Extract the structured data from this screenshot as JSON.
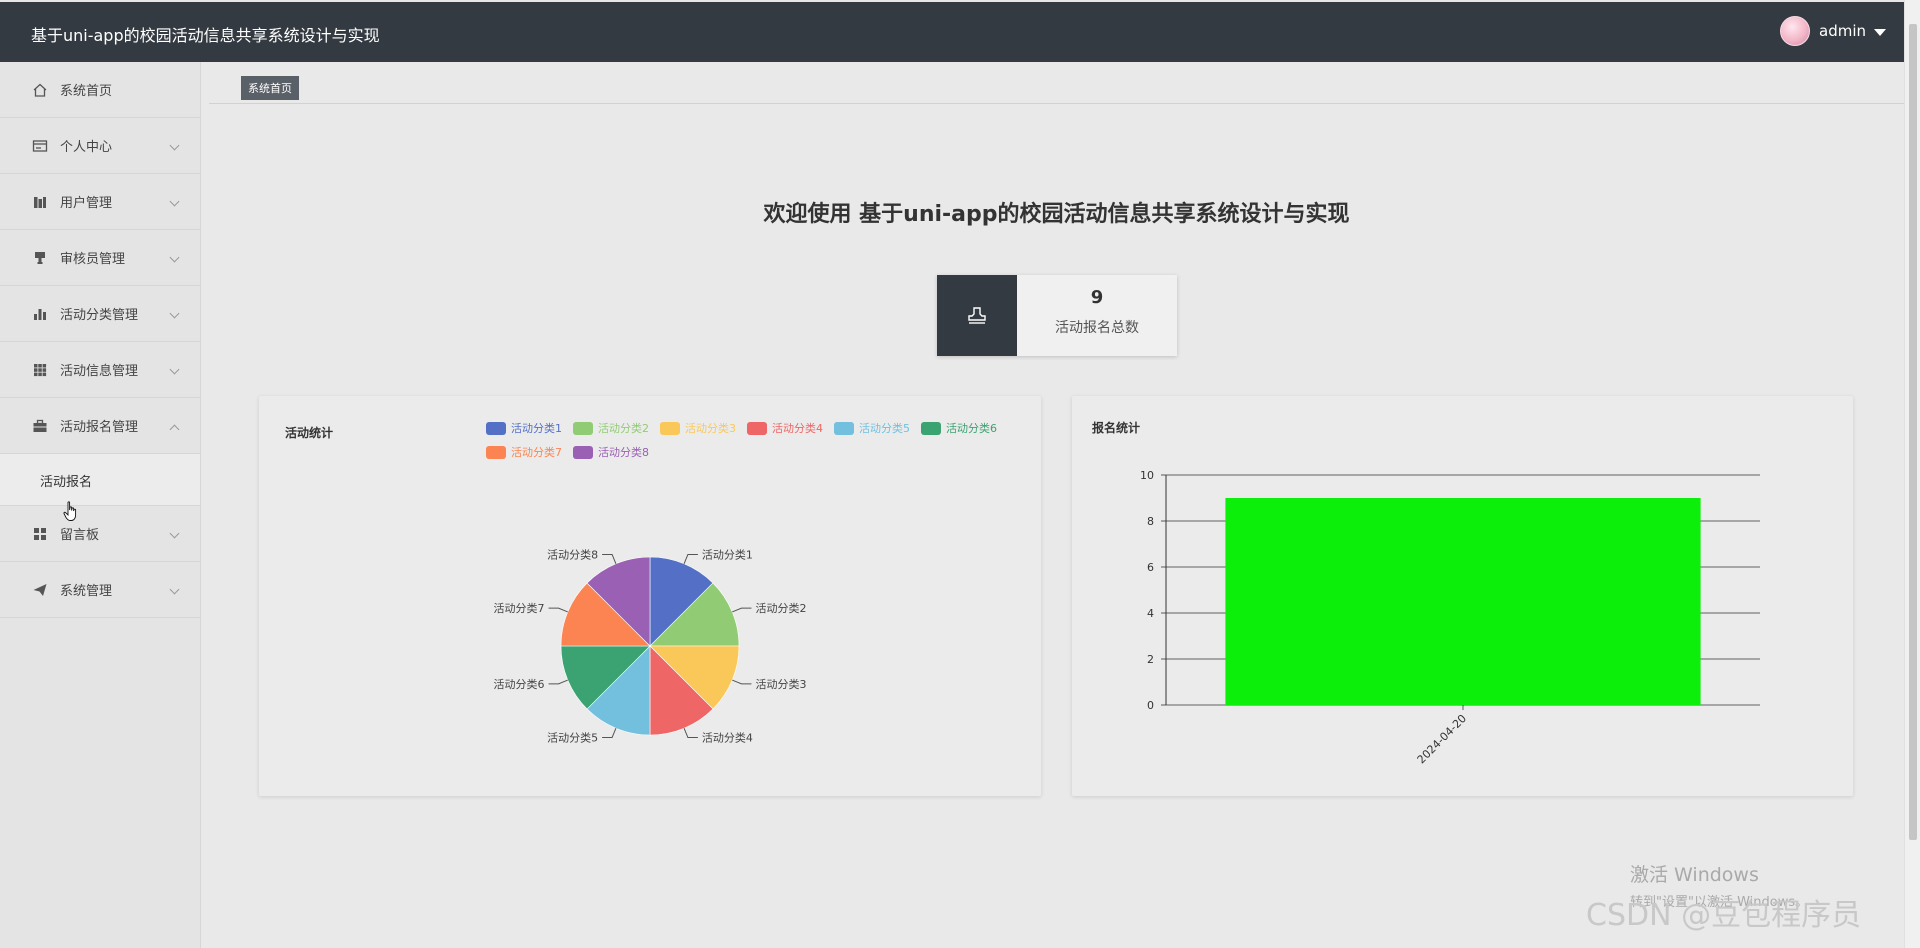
{
  "header": {
    "title": "基于uni-app的校园活动信息共享系统设计与实现",
    "user": "admin"
  },
  "sidebar": {
    "items": [
      {
        "label": "系统首页",
        "icon": "home-icon"
      },
      {
        "label": "个人中心",
        "icon": "id-card-icon"
      },
      {
        "label": "用户管理",
        "icon": "users-icon"
      },
      {
        "label": "审核员管理",
        "icon": "stamp-icon"
      },
      {
        "label": "活动分类管理",
        "icon": "bar-chart-icon"
      },
      {
        "label": "活动信息管理",
        "icon": "grid-icon"
      },
      {
        "label": "活动报名管理",
        "icon": "briefcase-icon"
      },
      {
        "label": "留言板",
        "icon": "dashboard-icon"
      },
      {
        "label": "系统管理",
        "icon": "send-icon"
      }
    ],
    "submenu": {
      "label": "活动报名"
    }
  },
  "breadcrumb": {
    "label": "系统首页"
  },
  "welcome": "欢迎使用 基于uni-app的校园活动信息共享系统设计与实现",
  "stat": {
    "value": "9",
    "label": "活动报名总数",
    "icon": "stamp-icon"
  },
  "left_panel": {
    "title": "活动统计"
  },
  "right_panel": {
    "title": "报名统计"
  },
  "chart_data": [
    {
      "type": "pie",
      "title": "活动统计",
      "legend_placement": "top-right",
      "categories": [
        "活动分类1",
        "活动分类2",
        "活动分类3",
        "活动分类4",
        "活动分类5",
        "活动分类6",
        "活动分类7",
        "活动分类8"
      ],
      "values": [
        1,
        1,
        1,
        1,
        1,
        1,
        1,
        1
      ],
      "colors": [
        "#5470c6",
        "#91cc75",
        "#fac858",
        "#ee6666",
        "#73c0de",
        "#3ba272",
        "#fc8452",
        "#9a60b4"
      ]
    },
    {
      "type": "bar",
      "title": "报名统计",
      "categories": [
        "2024-04-20"
      ],
      "values": [
        9
      ],
      "ylim": [
        0,
        10
      ],
      "yticks": [
        "0",
        "2",
        "4",
        "6",
        "8",
        "10"
      ],
      "grid": true,
      "bar_color": "#0bef0b"
    }
  ],
  "watermark": {
    "activate": "激活 Windows",
    "activate_sub": "转到\"设置\"以激活 Windows。",
    "csdn": "CSDN @豆包程序员"
  }
}
